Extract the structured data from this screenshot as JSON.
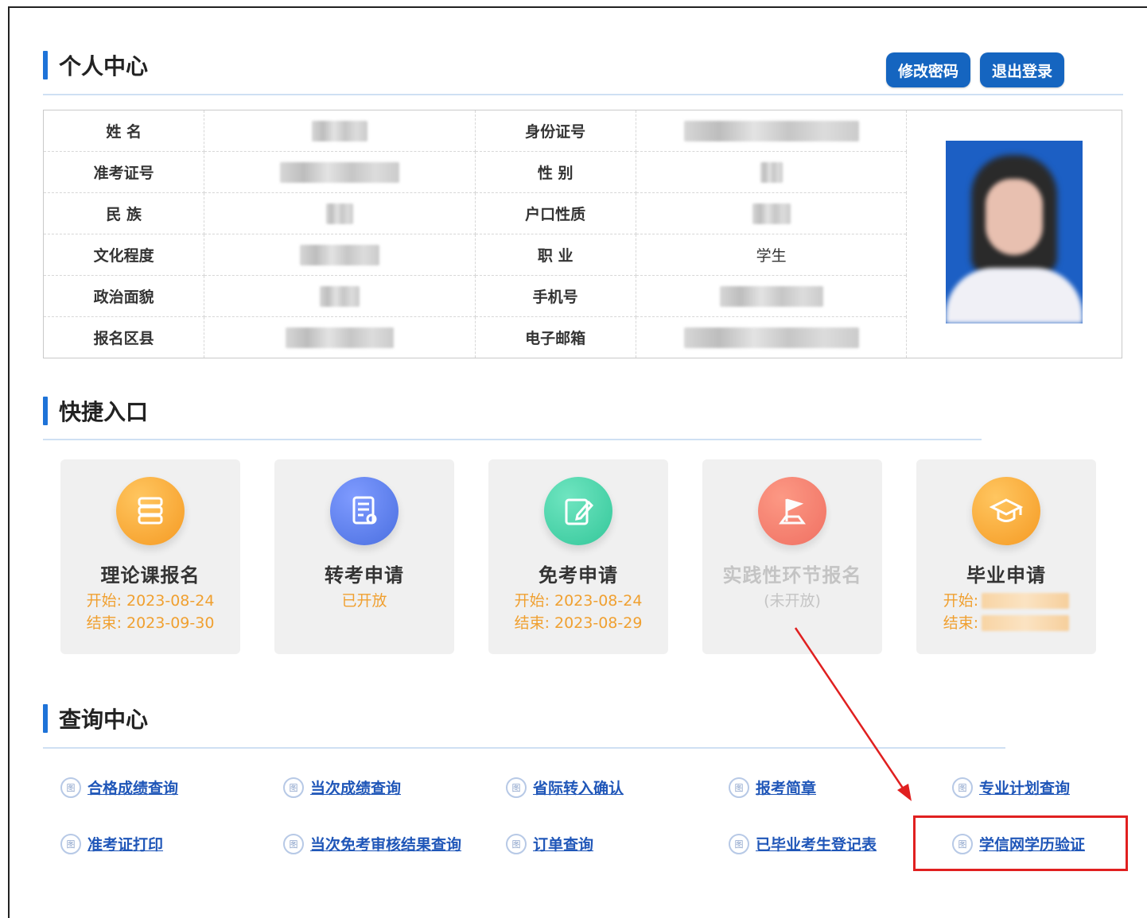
{
  "profile": {
    "title": "个人中心",
    "change_password_label": "修改密码",
    "logout_label": "退出登录",
    "fields": {
      "name_label": "姓  名",
      "id_label": "身份证号",
      "exam_no_label": "准考证号",
      "gender_label": "性  别",
      "ethnicity_label": "民  族",
      "household_label": "户口性质",
      "education_label": "文化程度",
      "occupation_label": "职  业",
      "occupation_value": "学生",
      "political_label": "政治面貌",
      "phone_label": "手机号",
      "district_label": "报名区县",
      "email_label": "电子邮箱"
    }
  },
  "quick": {
    "title": "快捷入口",
    "cards": [
      {
        "name": "理论课报名",
        "line1": "开始: 2023-08-24",
        "line2": "结束: 2023-09-30",
        "icon": "database-icon",
        "color": "#f59a23"
      },
      {
        "name": "转考申请",
        "line1": "已开放",
        "line2": "",
        "icon": "document-edit-icon",
        "color": "#4a6fe0"
      },
      {
        "name": "免考申请",
        "line1": "开始: 2023-08-24",
        "line2": "结束: 2023-08-29",
        "icon": "edit-icon",
        "color": "#34c79a"
      },
      {
        "name": "实践性环节报名",
        "line1": "(未开放)",
        "line2": "",
        "icon": "flag-icon",
        "color": "#f05a4a"
      },
      {
        "name": "毕业申请",
        "line1": "开始:",
        "line2": "结束:",
        "icon": "graduation-cap-icon",
        "color": "#f59a23"
      }
    ]
  },
  "query": {
    "title": "查询中心",
    "icon_char": "图",
    "links": [
      "合格成绩查询",
      "当次成绩查询",
      "省际转入确认",
      "报考简章",
      "专业计划查询",
      "准考证打印",
      "当次免考审核结果查询",
      "订单查询",
      "已毕业考生登记表",
      "学信网学历验证"
    ]
  },
  "annotation": {
    "highlight_color": "#e02020"
  }
}
